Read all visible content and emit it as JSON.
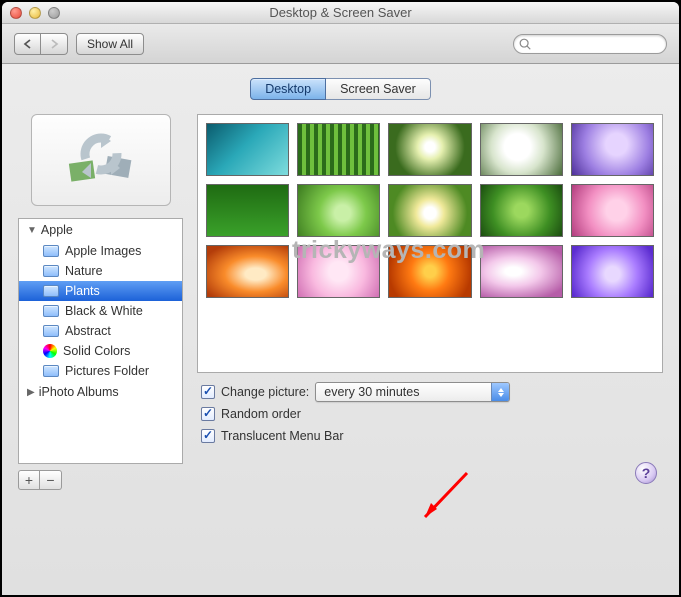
{
  "window": {
    "title": "Desktop & Screen Saver"
  },
  "toolbar": {
    "show_all_label": "Show All"
  },
  "tabs": {
    "desktop": "Desktop",
    "screen_saver": "Screen Saver"
  },
  "sidebar": {
    "group1": "Apple",
    "items": [
      "Apple Images",
      "Nature",
      "Plants",
      "Black & White",
      "Abstract",
      "Solid Colors",
      "Pictures Folder"
    ],
    "group2": "iPhoto Albums"
  },
  "options": {
    "change_picture_label": "Change picture:",
    "change_picture_value": "every 30 minutes",
    "random_order_label": "Random order",
    "translucent_menubar_label": "Translucent Menu Bar"
  },
  "watermark": "trickyways.com",
  "help_glyph": "?"
}
